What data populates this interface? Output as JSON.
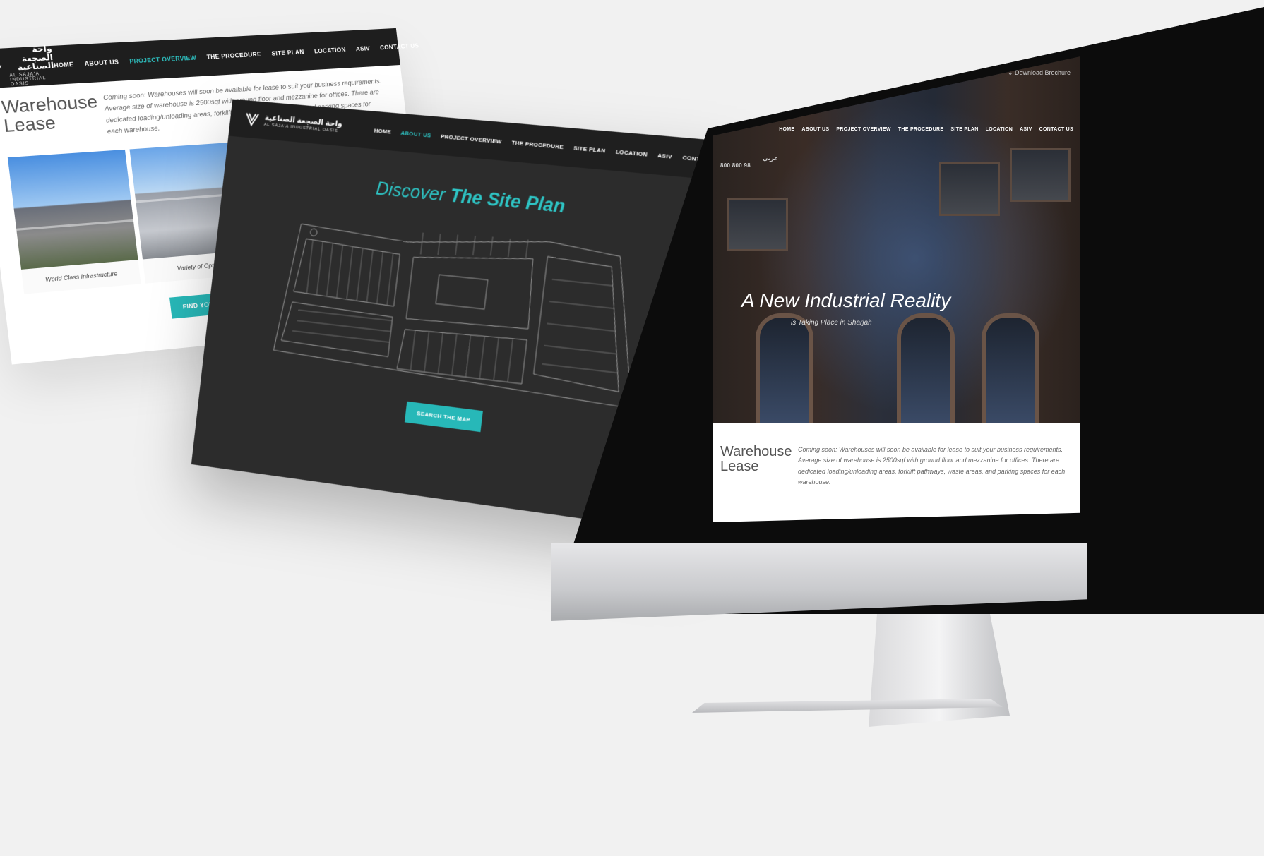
{
  "nav": {
    "items": [
      "HOME",
      "ABOUT US",
      "PROJECT OVERVIEW",
      "THE PROCEDURE",
      "SITE PLAN",
      "LOCATION",
      "ASIV",
      "CONTACT US"
    ]
  },
  "logo": {
    "arabic": "واحة الصجعة الصناعية",
    "english": "AL SAJA'A INDUSTRIAL OASIS"
  },
  "warehouse": {
    "title_line1": "Warehouse",
    "title_line2": "Lease",
    "text": "Coming soon: Warehouses will soon be available for lease to suit your business requirements. Average size of warehouse is 2500sqf with ground floor and mezzanine for offices. There are dedicated loading/unloading areas, forklift pathways, waste areas, and parking spaces for each warehouse.",
    "captions": [
      "World Class Infrastructure",
      "Variety of Options"
    ],
    "button": "FIND YOUR WAREHOUSE"
  },
  "siteplan": {
    "title_light": "Discover",
    "title_bold": "The Site Plan",
    "button": "SEARCH THE MAP"
  },
  "hero": {
    "brochure": "Download Brochure",
    "phone": "800 800 98",
    "lang": "عربي",
    "title": "A New Industrial Reality",
    "subtitle": "is Taking Place in Sharjah"
  },
  "colors": {
    "accent": "#2ec4c4",
    "nav_bg": "#1e1e1e",
    "dark_bg": "#2c2c2c",
    "page_bg": "#f1f1f1"
  }
}
